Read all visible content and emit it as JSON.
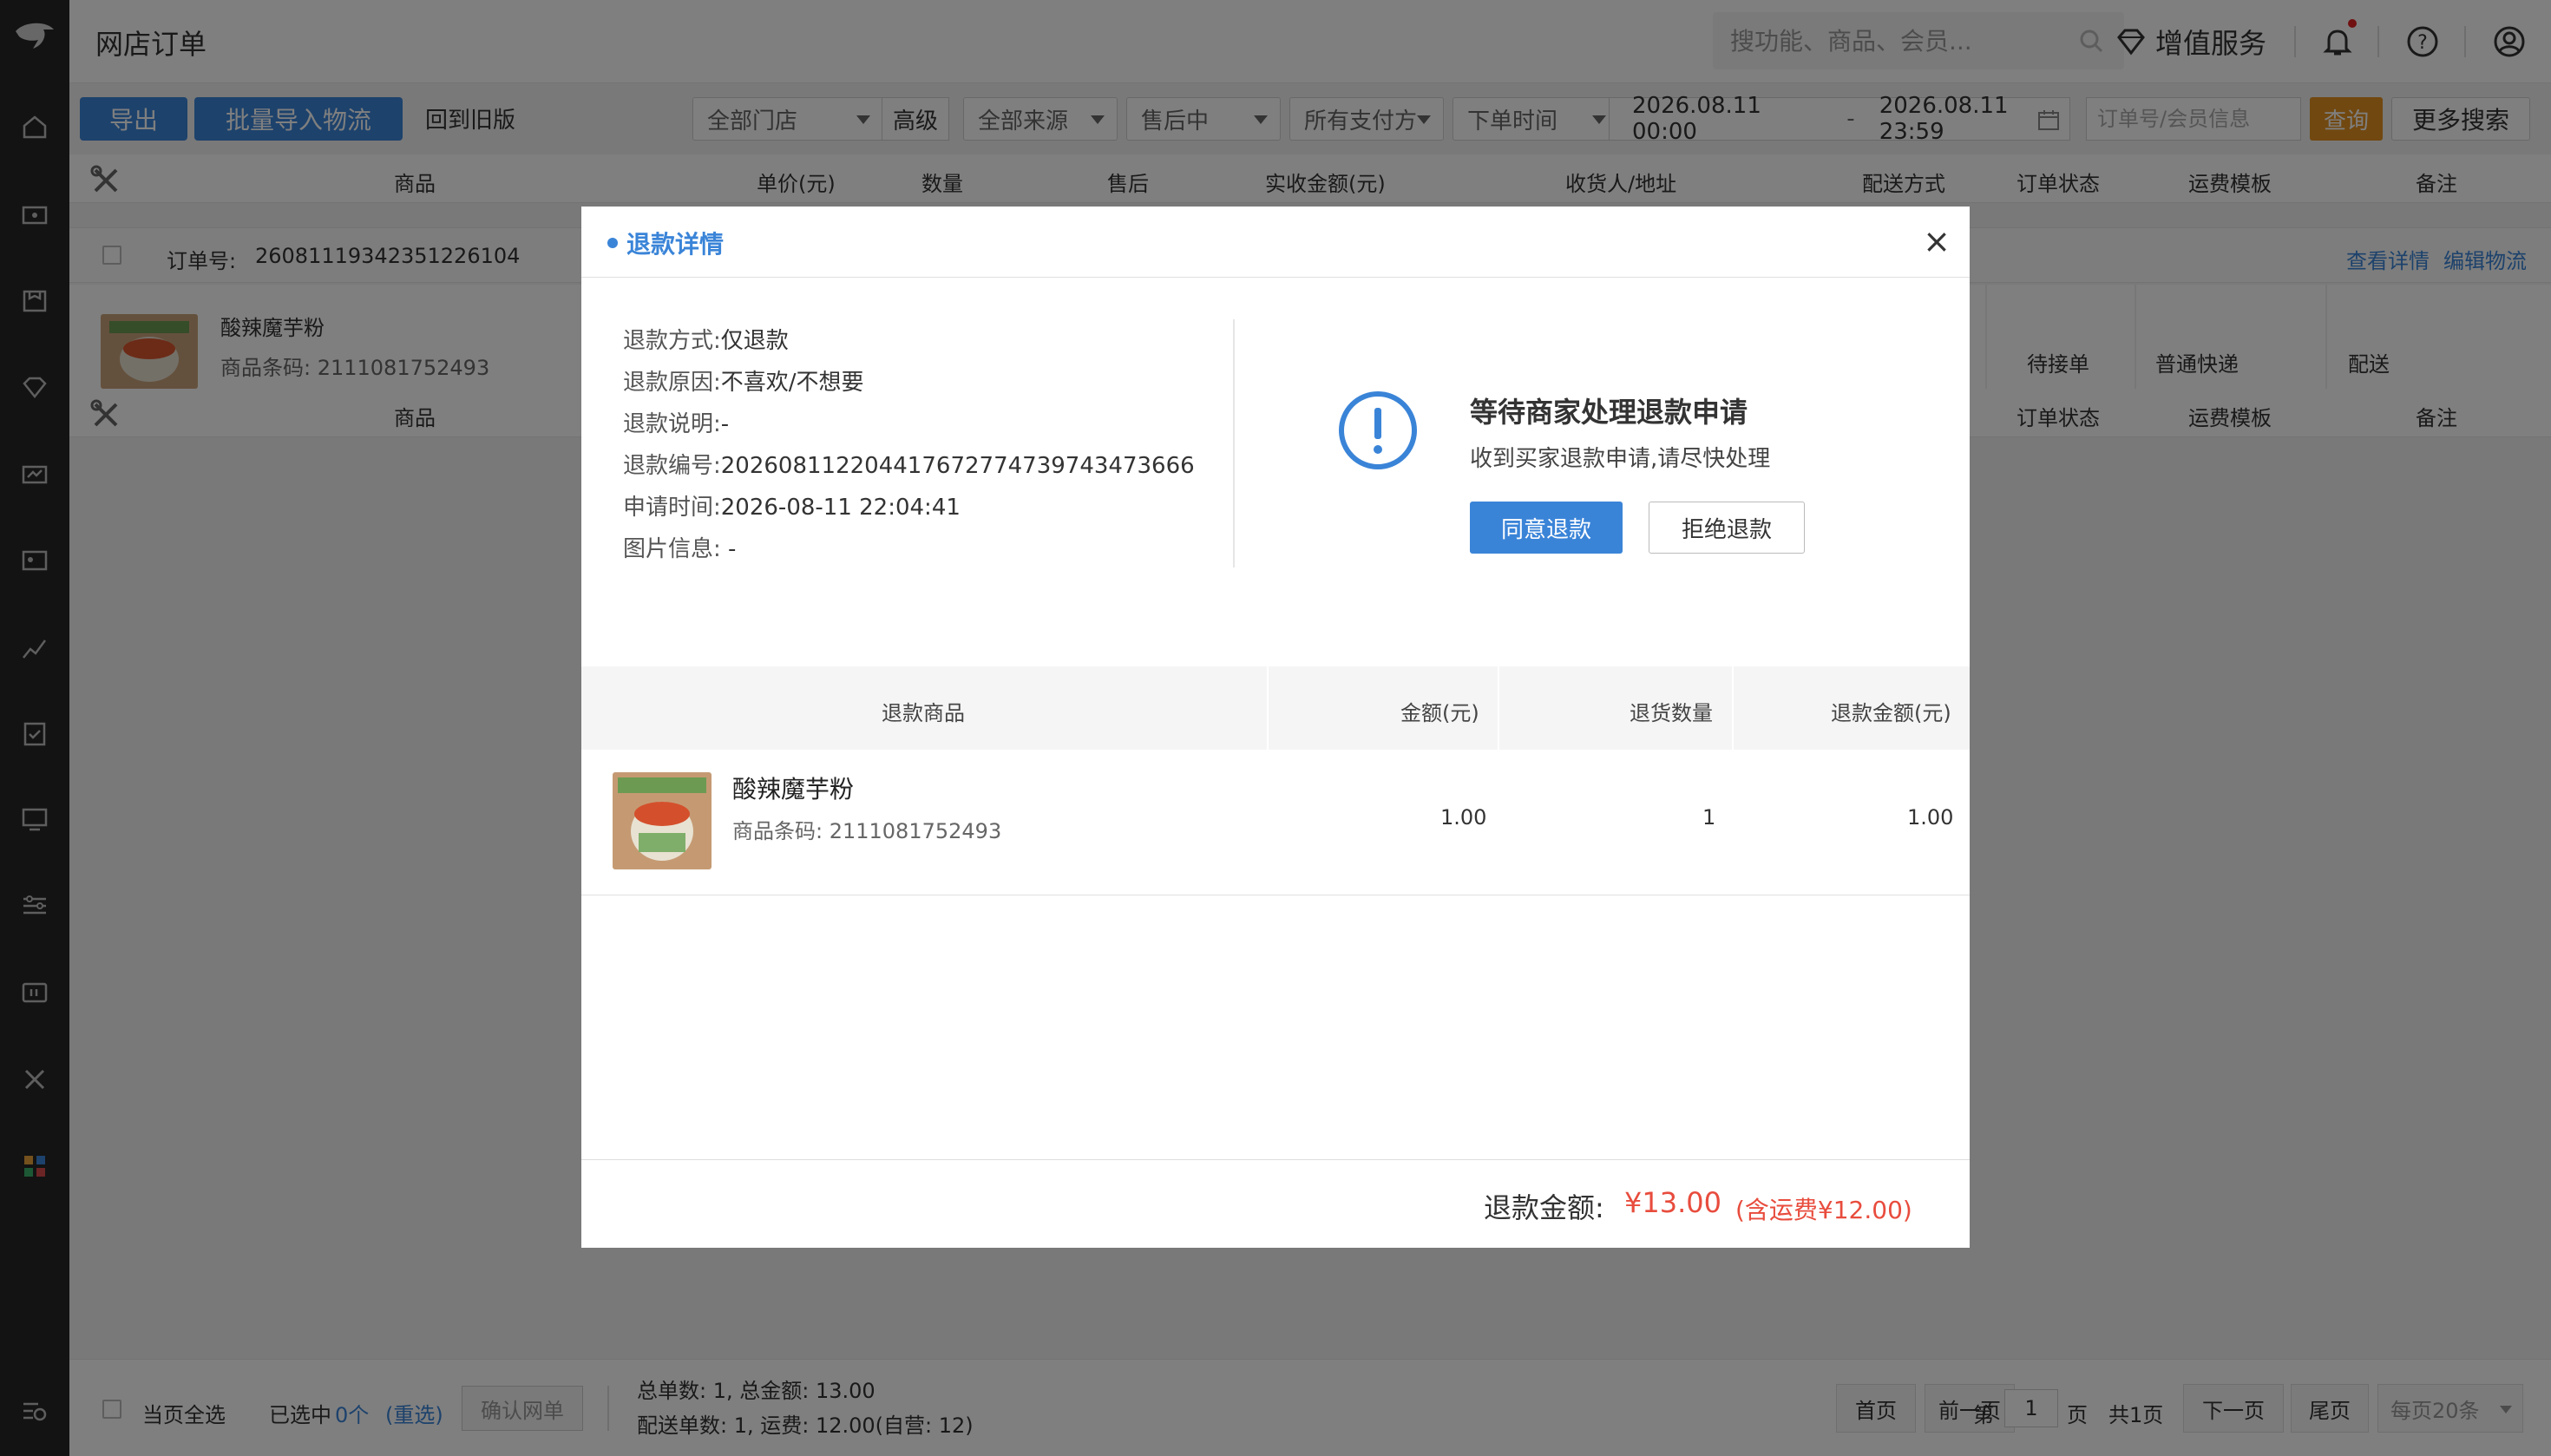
{
  "header": {
    "title": "网店订单",
    "search_placeholder": "搜功能、商品、会员...",
    "value_added": "增值服务"
  },
  "toolbar": {
    "export": "导出",
    "batch_import": "批量导入物流",
    "old_version": "回到旧版",
    "store_select": "全部门店",
    "advanced": "高级",
    "source_select": "全部来源",
    "aftersale_select": "售后中",
    "payment_select": "所有支付方",
    "time_select": "下单时间",
    "date_start": "2026.08.11 00:00",
    "date_sep": "-",
    "date_end": "2026.08.11 23:59",
    "order_placeholder": "订单号/会员信息",
    "query": "查询",
    "more_search": "更多搜索"
  },
  "table": {
    "columns": [
      "商品",
      "单价(元)",
      "数量",
      "售后",
      "实收金额(元)",
      "收货人/地址",
      "配送方式",
      "订单状态",
      "运费模板",
      "备注"
    ],
    "order_label": "订单号:",
    "order_no": "26081119342351226104",
    "view_detail": "查看详情",
    "edit_logistics": "编辑物流",
    "item_name": "酸辣魔芋粉",
    "item_barcode": "商品条码: 2111081752493",
    "status": "待接单",
    "delivery": "普通快递",
    "shipping_template": "配送"
  },
  "modal": {
    "title": "退款详情",
    "close": "×",
    "info": [
      {
        "k": "退款方式:",
        "v": "仅退款"
      },
      {
        "k": "退款原因:",
        "v": "不喜欢/不想要"
      },
      {
        "k": "退款说明:",
        "v": "-"
      },
      {
        "k": "退款编号:",
        "v": "20260811220441767277473974347366​6"
      },
      {
        "k": "申请时间:",
        "v": "2026-08-11 22:04:41"
      },
      {
        "k": "图片信息:",
        "v": " -"
      }
    ],
    "status_title": "等待商家处理退款申请",
    "status_sub": "收到买家退款申请,请尽快处理",
    "agree": "同意退款",
    "reject": "拒绝退款",
    "cols": [
      "退款商品",
      "金额(元)",
      "退货数量",
      "退款金额(元)"
    ],
    "item_name": "酸辣魔芋粉",
    "item_barcode": "商品条码: 2111081752493",
    "amount": "1.00",
    "qty": "1",
    "refund_amount": "1.00",
    "refund_label": "退款金额:",
    "refund_total": "¥13.00",
    "refund_ship": "(含运费¥12.00)"
  },
  "footer": {
    "select_page": "当页全选",
    "selected_prefix": "已选中",
    "selected_count": "0个",
    "reselect": "(重选)",
    "confirm": "确认网单",
    "totals": "总单数: 1, 总金额: 13.00",
    "delivery_totals": "配送单数: 1, 运费: 12.00(自营: 12)",
    "first": "首页",
    "prev": "前一页",
    "page_prefix": "第",
    "page_value": "1",
    "page_suffix": "页",
    "total_pages": "共1页",
    "next": "下一页",
    "last": "尾页",
    "per_page": "每页20条"
  },
  "colors": {
    "accent": "#3a84d8",
    "query": "#e39020",
    "refund_red": "#e84c3d",
    "rail": "#262626"
  }
}
